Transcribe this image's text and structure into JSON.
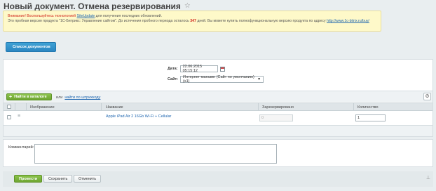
{
  "header": {
    "title": "Новый документ. Отмена резервирования",
    "star_icon": "star-icon"
  },
  "notice": {
    "line1_warn": "Внимание! Воспользуйтесь технологией",
    "line1_link": "SiteUpdate",
    "line1_rest": "для получения последних обновлений.",
    "line2_start": "Это пробная версия продукта \"1С-Битрикс: Управление сайтом\". До истечения пробного периода осталось",
    "line2_days": "347",
    "line2_mid": "дней. Вы можете купить полнофункциональную версию продукта по адресу",
    "line2_link": "http://www.1c-bitrix.ru/buy/"
  },
  "back_button": {
    "label": "Список документов"
  },
  "form": {
    "date_label": "Дата:",
    "date_value": "22.06.2015 05:15:12",
    "site_label": "Сайт:",
    "site_value": "Интернет-магазин (Сайт по умолчанию) (s1)"
  },
  "toolbar": {
    "add_button": "Найти в каталоге",
    "or_text": "или",
    "barcode_link": "найти по штрихкоду"
  },
  "table": {
    "columns": [
      "Изображение",
      "Название",
      "Зарезервировано",
      "Количество"
    ],
    "rows": [
      {
        "name": "Apple iPad Air 2 16Gb Wi-Fi + Cellular",
        "reserved": "0",
        "quantity": "1"
      }
    ]
  },
  "comment": {
    "label": "Комментарий:"
  },
  "footer": {
    "conduct": "Провести",
    "save": "Сохранить",
    "cancel": "Отменить"
  }
}
